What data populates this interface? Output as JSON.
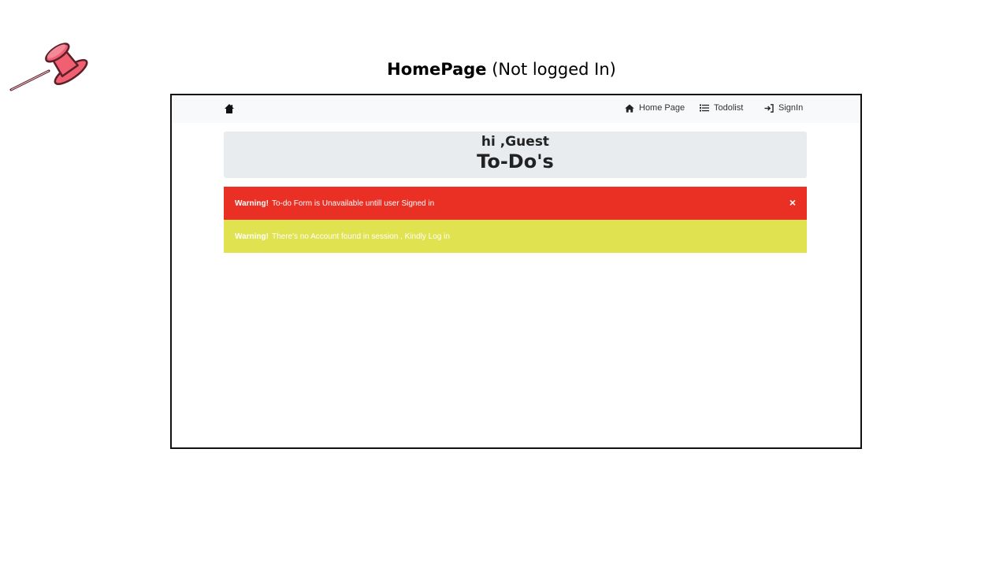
{
  "slide": {
    "title_bold": "HomePage",
    "title_rest": "(Not logged In)"
  },
  "navbar": {
    "brand_icon": "home-icon",
    "items": [
      {
        "label": "Home Page",
        "icon": "home-icon"
      },
      {
        "label": "Todolist",
        "icon": "list-icon"
      },
      {
        "label": "SignIn",
        "icon": "sign-in-icon"
      }
    ]
  },
  "jumbotron": {
    "greeting": "hi ,Guest",
    "heading": "To-Do's"
  },
  "alerts": [
    {
      "strong": "Warning!",
      "message": "To-do Form is Unavailable untill user Signed in",
      "color": "#ea2f25",
      "dismiss": "×"
    },
    {
      "strong": "Warning!",
      "message": "There's no Account found in session , Kindly Log in",
      "color": "#e0e250"
    }
  ],
  "colors": {
    "pin": "#f06071",
    "navbar_bg": "#f8f9fa",
    "jumbotron_bg": "#e9ecef"
  }
}
